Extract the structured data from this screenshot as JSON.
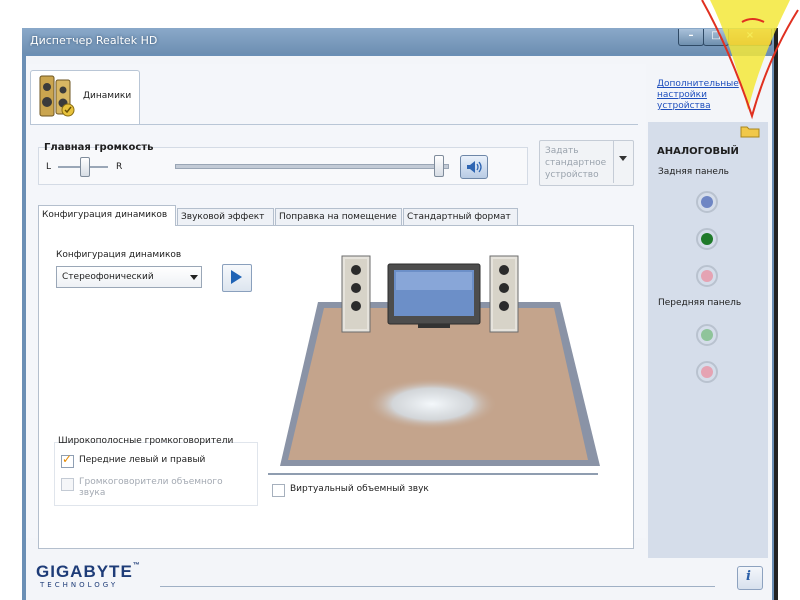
{
  "window": {
    "title": "Диспетчер Realtek HD",
    "minimize": "–",
    "maximize": "□",
    "close": "×"
  },
  "device_tab": {
    "label": "Динамики",
    "icon": "speaker-icon"
  },
  "volume": {
    "title": "Главная громкость",
    "left": "L",
    "right": "R",
    "mute_icon": "speaker-volume-icon",
    "default_device": "Задать стандартное устройство"
  },
  "tabs": [
    {
      "label": "Конфигурация динамиков",
      "active": true
    },
    {
      "label": "Звуковой эффект",
      "active": false
    },
    {
      "label": "Поправка на помещение",
      "active": false
    },
    {
      "label": "Стандартный формат",
      "active": false
    }
  ],
  "config": {
    "label": "Конфигурация динамиков",
    "selected": "Стереофонический",
    "play_icon": "play-icon"
  },
  "wideband": {
    "label": "Широкополосные громкоговорители",
    "front_lr": {
      "label": "Передние левый и правый",
      "checked": true
    },
    "surround": {
      "label": "Громкоговорители объемного звука",
      "checked": false,
      "enabled": false
    }
  },
  "virtual_surround": {
    "label": "Виртуальный объемный звук",
    "checked": false
  },
  "right_panel": {
    "advanced_link": "Дополнительные настройки устройства",
    "analog": "АНАЛОГОВЫЙ",
    "rear_panel": "Задняя панель",
    "front_panel": "Передняя панель",
    "rear_jacks": [
      "#6f86c4",
      "#1f7a2a",
      "#e5a3b3"
    ],
    "front_jacks": [
      "#8fc49a",
      "#e5a3b3"
    ],
    "folder_icon": "folder-icon"
  },
  "footer": {
    "brand": "GIGABYTE",
    "brand_tm": "™",
    "brand_sub": "TECHNOLOGY",
    "info_icon": "info-icon",
    "info_glyph": "i"
  },
  "colors": {
    "floor": "#c4a48c",
    "rug_glow": "#e9f1f8",
    "accent_blue": "#1f63b5",
    "annotation_yellow": "#f3e83a",
    "annotation_red": "#e03020"
  }
}
